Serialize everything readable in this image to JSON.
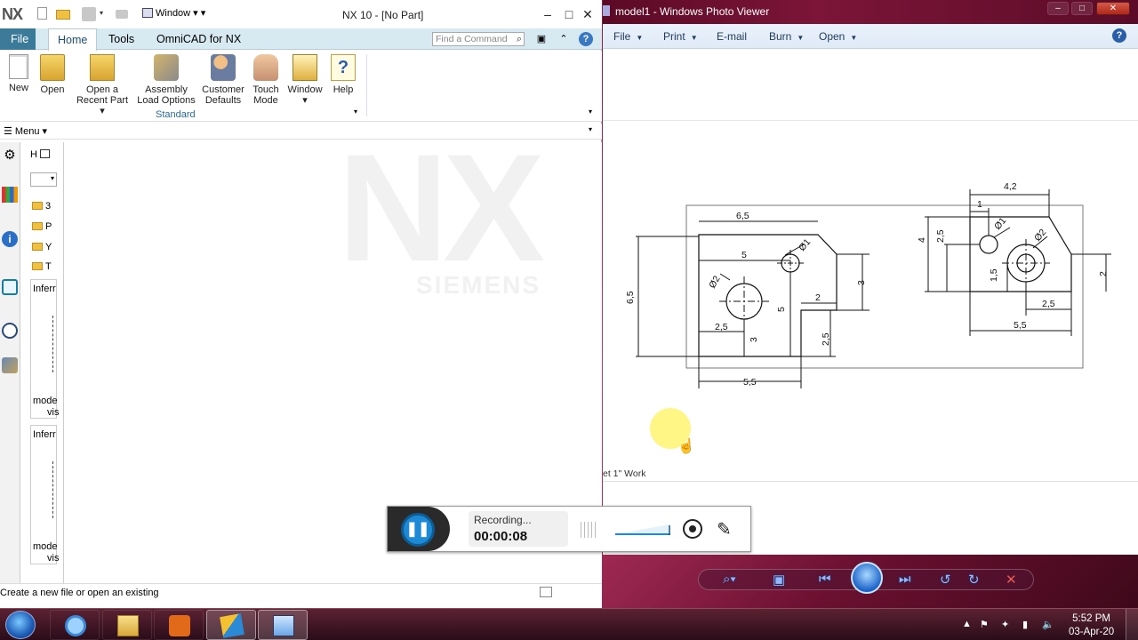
{
  "nx": {
    "logo": "NX",
    "window_menu": "Window",
    "title": "NX 10 - [No Part]",
    "tabs": [
      "File",
      "Home",
      "Tools",
      "OmniCAD for NX"
    ],
    "find_placeholder": "Find a Command",
    "ribbon": {
      "new": "New",
      "open": "Open",
      "open_recent_l1": "Open a",
      "open_recent_l2": "Recent Part",
      "assembly_l1": "Assembly",
      "assembly_l2": "Load Options",
      "customer_l1": "Customer",
      "customer_l2": "Defaults",
      "touch_l1": "Touch",
      "touch_l2": "Mode",
      "window": "Window",
      "help": "Help",
      "group_label": "Standard"
    },
    "menu": "Menu",
    "nav": {
      "h": "H",
      "folders": [
        "3",
        "P",
        "Y",
        "T"
      ],
      "box1_title": "Inferr",
      "box1_footer_1": "mode",
      "box1_footer_2": "vis",
      "box2_title": "Inferr",
      "box2_footer_1": "mode",
      "box2_footer_2": "vis"
    },
    "watermark_brand": "NX",
    "watermark_company": "SIEMENS",
    "status": "Create a new file or open an existing"
  },
  "photo_viewer": {
    "title": "model1 - Windows Photo Viewer",
    "menu": [
      "File",
      "Print",
      "E-mail",
      "Burn",
      "Open"
    ],
    "sheet_label": "et 1\" Work",
    "drawing": {
      "front": {
        "width_top": "6,5",
        "inner_width": "5",
        "hole_small": "Ø1",
        "hole_large": "Ø2",
        "height_total": "6,5",
        "step_right": "3",
        "notch_width": "2",
        "hole_offset_x": "2,5",
        "hole_offset_y": "3",
        "small_hole_height": "5",
        "notch_height": "2,5",
        "bottom_width": "5,5"
      },
      "side": {
        "top_width": "4,2",
        "small_offset": "1",
        "hole_small": "Ø1",
        "hole_large": "Ø2",
        "height_total": "4",
        "height_small": "2,5",
        "hole_height": "1,5",
        "right_height": "2",
        "hole_x": "2,5",
        "bottom_width": "5,5"
      }
    }
  },
  "recorder": {
    "status": "Recording...",
    "time": "00:00:08"
  },
  "taskbar": {
    "time": "5:52 PM",
    "date": "03-Apr-20"
  }
}
